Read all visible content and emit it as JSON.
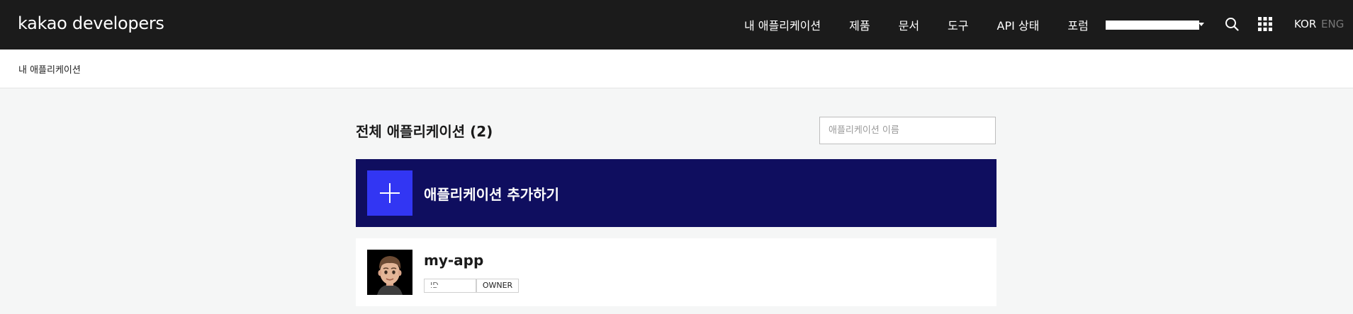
{
  "header": {
    "logo_main": "kakao",
    "logo_sub": "developers",
    "nav": [
      "내 애플리케이션",
      "제품",
      "문서",
      "도구",
      "API 상태",
      "포럼"
    ],
    "lang_kor": "KOR",
    "lang_eng": "ENG",
    "icons": [
      "search-icon",
      "apps-grid-icon",
      "chevron-down-icon"
    ]
  },
  "breadcrumb": {
    "current": "내 애플리케이션"
  },
  "main": {
    "title": "전체 애플리케이션 (2)",
    "search_placeholder": "애플리케이션 이름",
    "add_app_label": "애플리케이션 추가하기",
    "apps": [
      {
        "name": "my-app",
        "id_badge": "ID 1062007",
        "role_badge": "OWNER"
      }
    ]
  },
  "colors": {
    "topbar_bg": "#1b1b1b",
    "add_card_bg": "#0f0e5f",
    "add_icon_bg": "#3236f3",
    "page_bg": "#f5f6f6"
  }
}
